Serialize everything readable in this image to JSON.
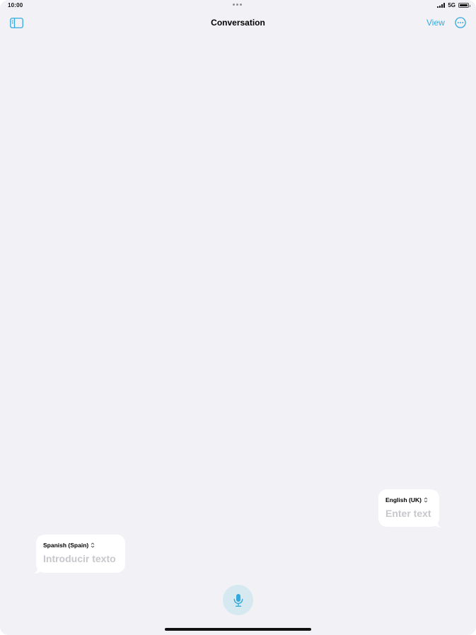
{
  "status": {
    "time": "10:00",
    "network": "5G"
  },
  "nav": {
    "title": "Conversation",
    "view_label": "View"
  },
  "bubbles": {
    "english": {
      "language": "English (UK)",
      "placeholder": "Enter text"
    },
    "spanish": {
      "language": "Spanish (Spain)",
      "placeholder": "Introducir texto"
    }
  },
  "icons": {
    "sidebar": "sidebar-icon",
    "more": "ellipsis-circle-icon",
    "microphone": "microphone-icon",
    "language_picker": "chevron-up-down-icon"
  },
  "colors": {
    "accent": "#34aadc",
    "background": "#f1f1f6",
    "mic_background": "#d6e9f0",
    "placeholder": "#c7c7cc"
  }
}
